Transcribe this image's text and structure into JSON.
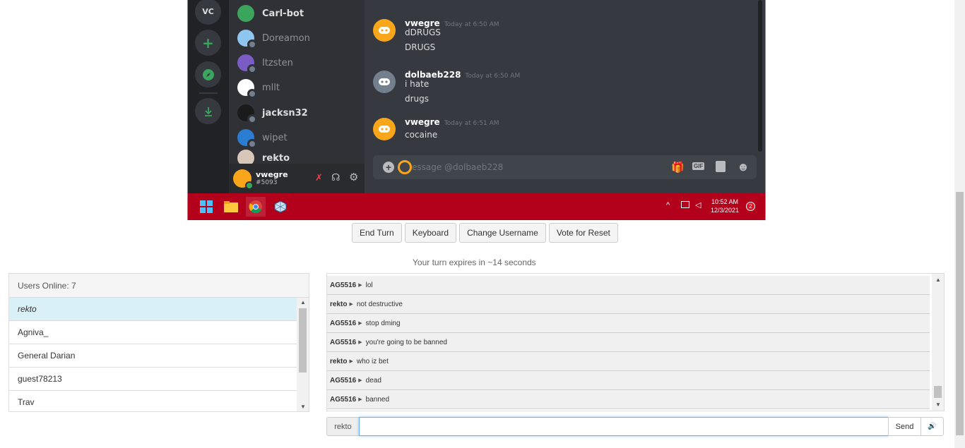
{
  "colors": {
    "discord_blurple": "#5865f2",
    "discord_orange": "#faa61a",
    "taskbar": "#b3001b",
    "active_user": "#d9f0f8"
  },
  "remote_screen": {
    "guild_initials": "VC",
    "members": [
      {
        "name": "Carl-bot",
        "bold": true
      },
      {
        "name": "Doreamon",
        "bold": false
      },
      {
        "name": "Itzsten",
        "bold": false
      },
      {
        "name": "mllt",
        "bold": false
      },
      {
        "name": "jacksn32",
        "bold": true
      },
      {
        "name": "wipet",
        "bold": false
      },
      {
        "name": "rekto",
        "bold": true
      }
    ],
    "user_panel": {
      "name": "vwegre",
      "tag": "#5093"
    },
    "messages": [
      {
        "author": "vwegre",
        "time": "Today at 6:50 AM",
        "lines": [
          "dDRUGS",
          "DRUGS"
        ]
      },
      {
        "author": "dolbaeb228",
        "time": "Today at 6:50 AM",
        "lines": [
          "i hate",
          "drugs"
        ]
      },
      {
        "author": "vwegre",
        "time": "Today at 6:51 AM",
        "lines": [
          "cocaine"
        ]
      }
    ],
    "composer_placeholder": "essage @dolbaeb228",
    "gif_label": "GIF",
    "clock": {
      "time": "10:52 AM",
      "date": "12/3/2021"
    },
    "notification_count": "2"
  },
  "controls": {
    "end_turn": "End Turn",
    "keyboard": "Keyboard",
    "change_username": "Change Username",
    "vote_reset": "Vote for Reset"
  },
  "turn_text": "Your turn expires in ~14 seconds",
  "users": {
    "header": "Users Online: 7",
    "list": [
      "rekto",
      "Agniva_",
      "General Darian",
      "guest78213",
      "Trav"
    ]
  },
  "chat_log": [
    {
      "user": "AG5516",
      "text": "lol"
    },
    {
      "user": "rekto",
      "text": "not destructive"
    },
    {
      "user": "AG5516",
      "text": "stop dming"
    },
    {
      "user": "AG5516",
      "text": "you're going to be banned"
    },
    {
      "user": "rekto",
      "text": "who iz bet"
    },
    {
      "user": "AG5516",
      "text": "dead"
    },
    {
      "user": "AG5516",
      "text": "banned"
    }
  ],
  "input": {
    "nick": "rekto",
    "value": "",
    "send_label": "Send",
    "sound_icon": "🔊"
  }
}
